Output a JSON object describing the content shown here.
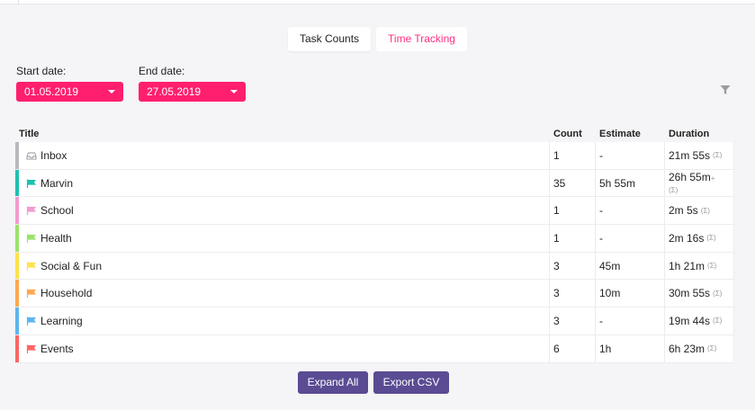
{
  "tabs": [
    {
      "label": "Task Counts",
      "active": true
    },
    {
      "label": "Time Tracking",
      "active": false
    }
  ],
  "filters": {
    "start": {
      "label": "Start date:",
      "value": "01.05.2019"
    },
    "end": {
      "label": "End date:",
      "value": "27.05.2019"
    },
    "filter_icon": "filter-funnel-icon"
  },
  "table": {
    "headers": {
      "title": "Title",
      "count": "Count",
      "estimate": "Estimate",
      "duration": "Duration"
    },
    "sigma": "(Σ)",
    "rows": [
      {
        "title": "Inbox",
        "icon": "inbox-tray-icon",
        "color": "#b9b9bd",
        "count": "1",
        "estimate": "-",
        "duration": "21m 55s",
        "plus": ""
      },
      {
        "title": "Marvin",
        "icon": "flag-icon",
        "color": "#1fc0b0",
        "count": "35",
        "estimate": "5h 55m",
        "duration": "26h 55m",
        "plus": "+"
      },
      {
        "title": "School",
        "icon": "flag-icon",
        "color": "#f39ad0",
        "count": "1",
        "estimate": "-",
        "duration": "2m 5s",
        "plus": ""
      },
      {
        "title": "Health",
        "icon": "flag-icon",
        "color": "#9be36a",
        "count": "1",
        "estimate": "-",
        "duration": "2m 16s",
        "plus": ""
      },
      {
        "title": "Social & Fun",
        "icon": "flag-icon",
        "color": "#ffe24a",
        "count": "3",
        "estimate": "45m",
        "duration": "1h 21m",
        "plus": ""
      },
      {
        "title": "Household",
        "icon": "flag-icon",
        "color": "#ffa84f",
        "count": "3",
        "estimate": "10m",
        "duration": "30m 55s",
        "plus": ""
      },
      {
        "title": "Learning",
        "icon": "flag-icon",
        "color": "#5db5f0",
        "count": "3",
        "estimate": "-",
        "duration": "19m 44s",
        "plus": ""
      },
      {
        "title": "Events",
        "icon": "flag-icon",
        "color": "#ff6565",
        "count": "6",
        "estimate": "1h",
        "duration": "6h 23m",
        "plus": ""
      }
    ]
  },
  "buttons": {
    "expand": "Expand All",
    "export": "Export CSV"
  },
  "colors": {
    "accent": "#ff1f6e",
    "button": "#5a4b93"
  }
}
